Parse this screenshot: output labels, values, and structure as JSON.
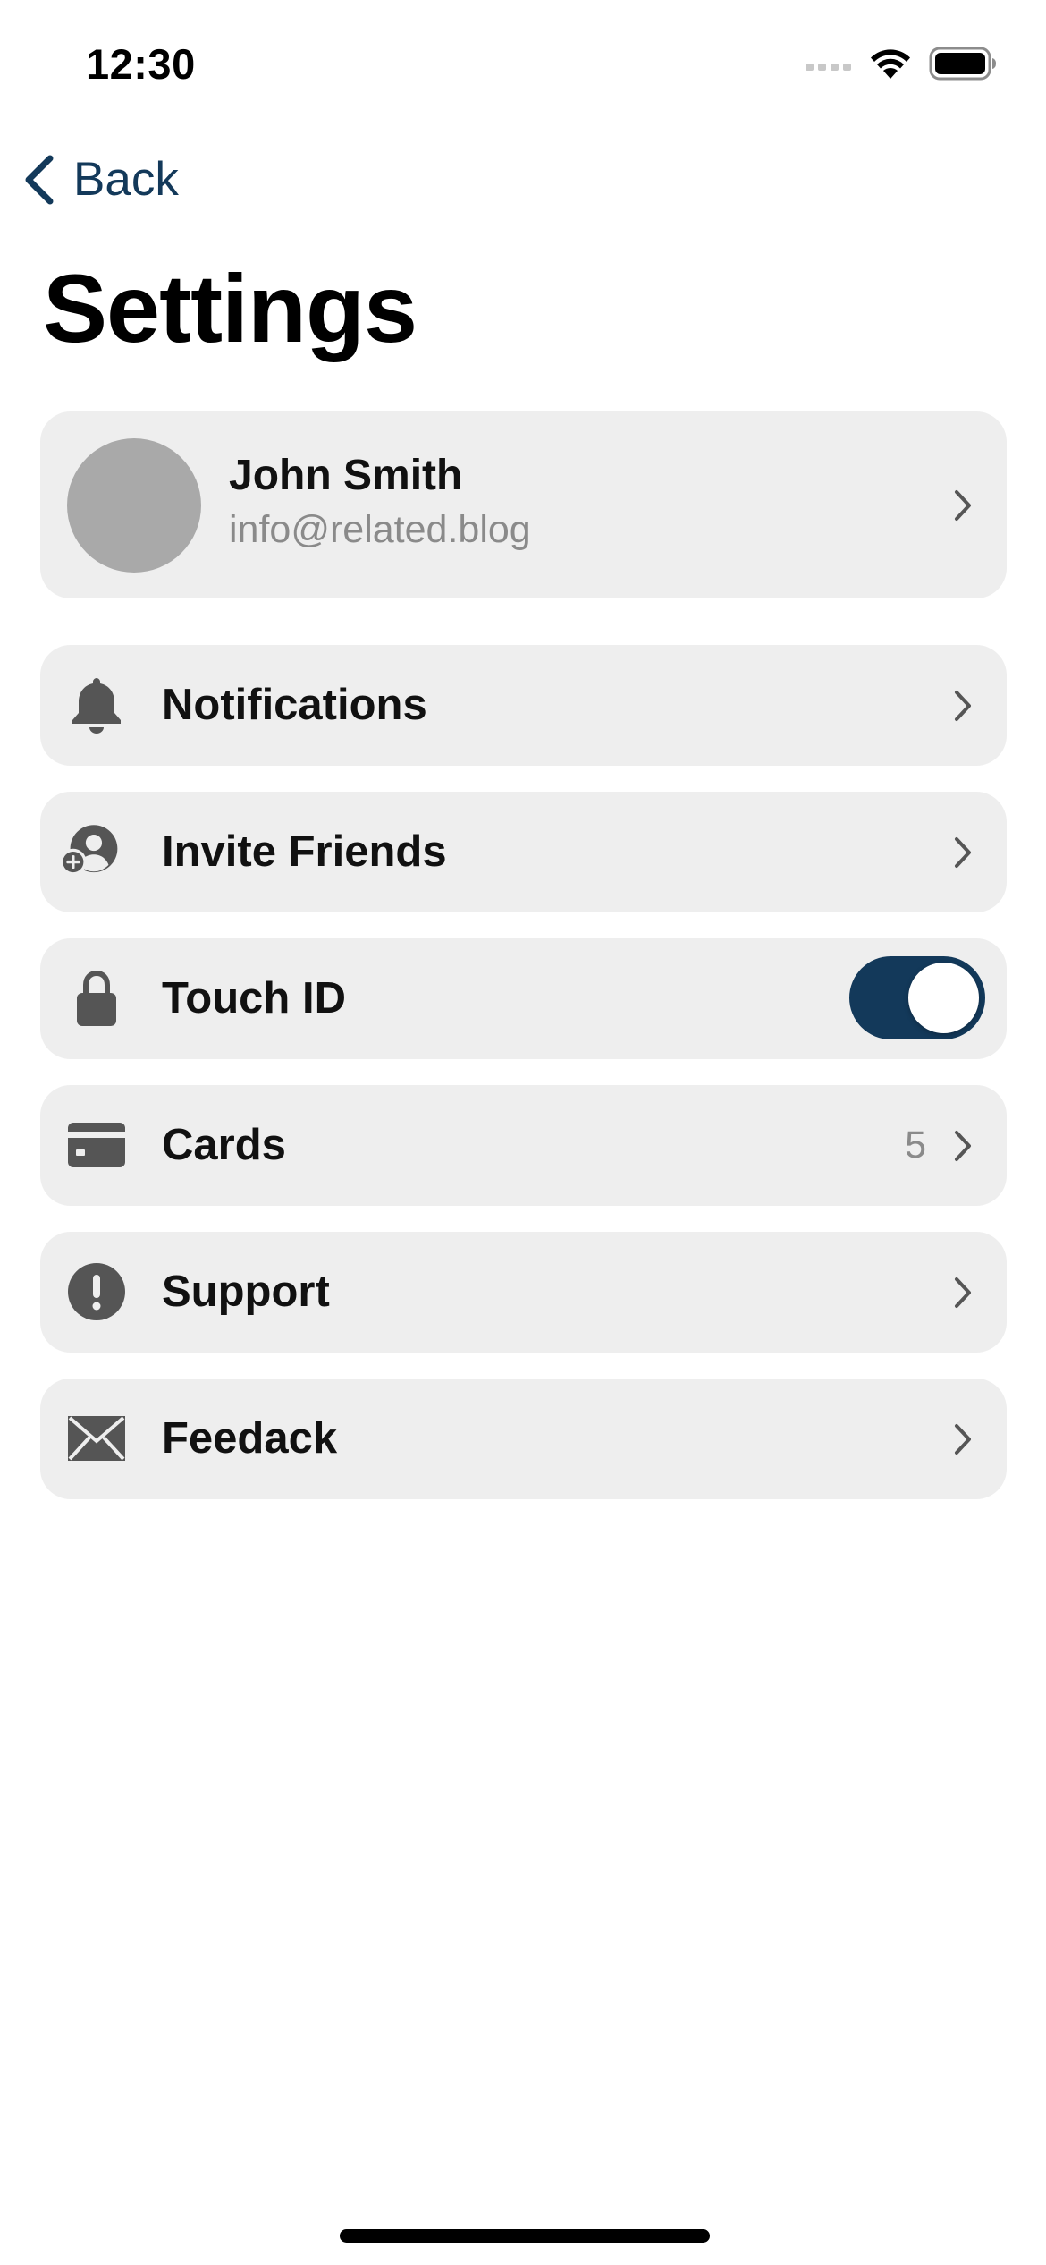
{
  "status_bar": {
    "time": "12:30"
  },
  "nav": {
    "back_label": "Back"
  },
  "page": {
    "title": "Settings"
  },
  "profile": {
    "name": "John Smith",
    "email": "info@related.blog"
  },
  "rows": [
    {
      "label": "Notifications",
      "icon": "bell-icon"
    },
    {
      "label": "Invite Friends",
      "icon": "add-person-icon"
    },
    {
      "label": "Touch ID",
      "icon": "lock-icon",
      "toggle_on": true
    },
    {
      "label": "Cards",
      "icon": "credit-card-icon",
      "count": "5"
    },
    {
      "label": "Support",
      "icon": "exclamation-icon"
    },
    {
      "label": "Feedack",
      "icon": "envelope-icon"
    }
  ],
  "colors": {
    "accent": "#13395a",
    "card_bg": "#eeeeee",
    "icon_gray": "#555555",
    "secondary_text": "#8a8a8a",
    "avatar_placeholder": "#a9a9a9"
  }
}
